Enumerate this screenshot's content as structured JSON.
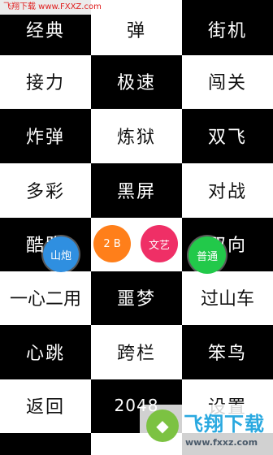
{
  "watermark": {
    "top": "飞翔下载 www.FXXZ.com"
  },
  "modes": [
    [
      "经典",
      "弹",
      "街机"
    ],
    [
      "接力",
      "极速",
      "闯关"
    ],
    [
      "炸弹",
      "炼狱",
      "双飞"
    ],
    [
      "多彩",
      "黑屏",
      "对战"
    ],
    [
      "酷跑",
      "",
      "双向"
    ],
    [
      "一心二用",
      "噩梦",
      "过山车"
    ],
    [
      "心跳",
      "跨栏",
      "笨鸟"
    ],
    [
      "返回",
      "2048",
      "设置"
    ],
    [
      "",
      "",
      ""
    ]
  ],
  "bubbles": [
    {
      "label": "山炮",
      "color": "#2f8fe0"
    },
    {
      "label": "2 B",
      "color": "#ff7f1a"
    },
    {
      "label": "文艺",
      "color": "#ef2f66"
    },
    {
      "label": "普通",
      "color": "#22c94a"
    }
  ],
  "logo": {
    "name": "飞翔下载",
    "url": "www.fxxz.com"
  }
}
